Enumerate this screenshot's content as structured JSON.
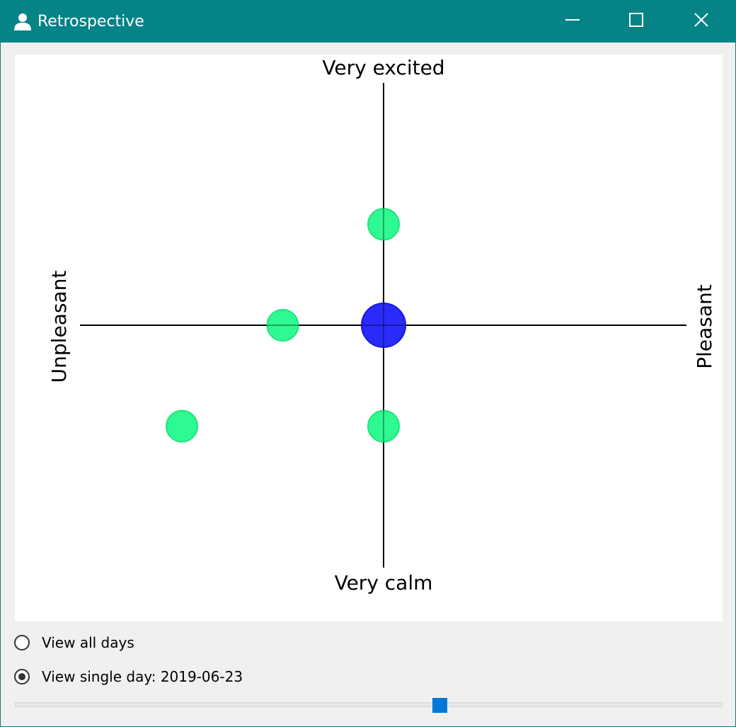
{
  "window": {
    "title": "Retrospective",
    "icon": "user-icon",
    "controls": [
      "minimize-icon",
      "maximize-icon",
      "close-icon"
    ]
  },
  "plot": {
    "labels": {
      "top": "Very excited",
      "bottom": "Very calm",
      "left": "Unpleasant",
      "right": "Pleasant"
    },
    "points": [
      {
        "pleasantness": 0,
        "excitement": 1,
        "kind": "entry",
        "color": "#2efa92"
      },
      {
        "pleasantness": -1,
        "excitement": 0,
        "kind": "entry",
        "color": "#2efa92"
      },
      {
        "pleasantness": -2,
        "excitement": -1,
        "kind": "entry",
        "color": "#2efa92"
      },
      {
        "pleasantness": 0,
        "excitement": -1,
        "kind": "entry",
        "color": "#2efa92"
      },
      {
        "pleasantness": 0,
        "excitement": 0,
        "kind": "average",
        "color": "#2a2afb"
      }
    ],
    "range": {
      "pleasantness": [
        -3,
        3
      ],
      "excitement": [
        -3,
        3
      ]
    }
  },
  "controls": {
    "view_all_label": "View all days",
    "view_single_label": "View single day: 2019-06-23",
    "selected": "single",
    "day_position": 0.6
  },
  "colors": {
    "titlebar": "#058387",
    "entry_point": "#2efa92",
    "average_point": "#2a2afb",
    "slider_thumb": "#0078d7"
  }
}
